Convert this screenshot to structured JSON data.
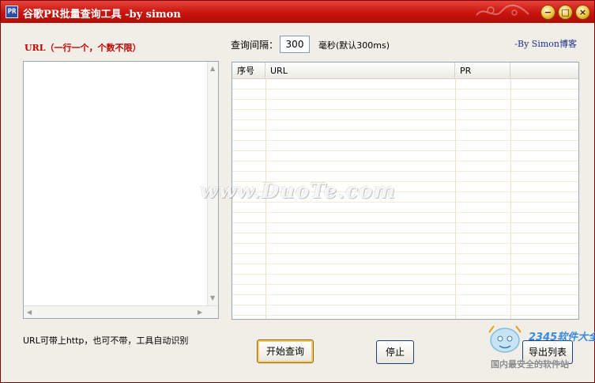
{
  "window": {
    "title": "谷歌PR批量查询工具 -by simon",
    "icon_text": "PR",
    "controls": {
      "minimize": "−",
      "maximize": "□",
      "close": "×"
    }
  },
  "left_panel": {
    "label": "URL（一行一个，个数不限）",
    "hint": "URL可带上http，也可不带，工具自动识别"
  },
  "settings": {
    "interval_label": "查询间隔：",
    "interval_value": "300",
    "interval_unit": "毫秒(默认300ms)",
    "blog_link": "-By Simon博客"
  },
  "table": {
    "columns": [
      "序号",
      "URL",
      "PR",
      ""
    ],
    "rows": []
  },
  "buttons": {
    "start": "开始查询",
    "stop": "停止",
    "export": "导出列表"
  },
  "watermarks": {
    "center": "www.DuoTe.com",
    "brand": "2345软件大全",
    "tagline": "国内最安全的软件站"
  },
  "colors": {
    "titlebar": "#c8140e",
    "url_label": "#c00000",
    "link": "#1a2e8a",
    "row_line": "#f2ecd2"
  }
}
